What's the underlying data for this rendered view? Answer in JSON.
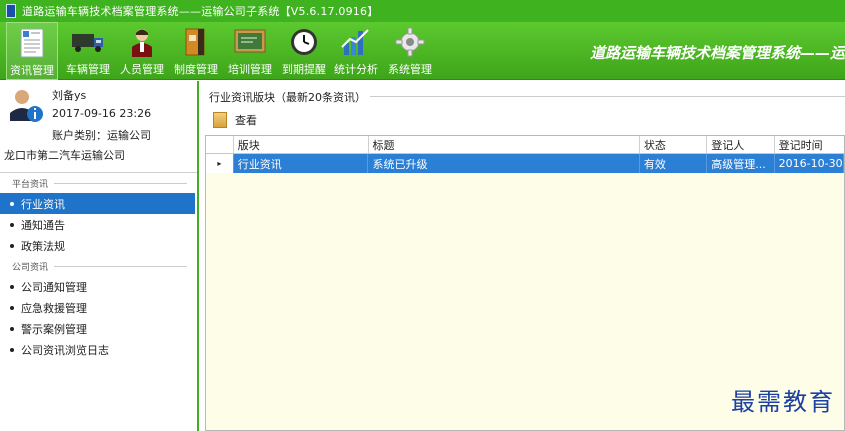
{
  "window": {
    "title": "道路运输车辆技术档案管理系统——运输公司子系统【V5.6.17.0916】"
  },
  "toolbar": {
    "items": [
      {
        "label": "资讯管理",
        "icon": "document-icon"
      },
      {
        "label": "车辆管理",
        "icon": "truck-icon"
      },
      {
        "label": "人员管理",
        "icon": "person-icon"
      },
      {
        "label": "制度管理",
        "icon": "binder-icon"
      },
      {
        "label": "培训管理",
        "icon": "blackboard-icon"
      },
      {
        "label": "到期提醒",
        "icon": "clock-icon"
      },
      {
        "label": "统计分析",
        "icon": "bar-chart-icon"
      },
      {
        "label": "系统管理",
        "icon": "gear-icon"
      }
    ],
    "brand": "道路运输车辆技术档案管理系统——运"
  },
  "user": {
    "name": "刘备ys",
    "login_time": "2017-09-16 23:26",
    "account_type": "账户类别：运输公司",
    "company": "龙口市第二汽车运输公司"
  },
  "nav": {
    "platform_header": "平台资讯",
    "platform_items": [
      "行业资讯",
      "通知通告",
      "政策法规"
    ],
    "company_header": "公司资讯",
    "company_items": [
      "公司通知管理",
      "应急救援管理",
      "警示案例管理",
      "公司资讯浏览日志"
    ]
  },
  "main": {
    "group_title": "行业资讯版块（最新20条资讯）",
    "view_button": "查看",
    "columns": [
      "版块",
      "标题",
      "状态",
      "登记人",
      "登记时间"
    ],
    "rows": [
      {
        "indicator": "▸",
        "section": "行业资讯",
        "title": "系统已升级",
        "status": "有效",
        "registrar": "高级管理...",
        "time": "2016-10-30"
      }
    ]
  },
  "watermark": "最需教育",
  "colors": {
    "toolbar_green": "#3fb31f",
    "selection_blue": "#2b7fd4",
    "grid_background": "#fefde8"
  }
}
